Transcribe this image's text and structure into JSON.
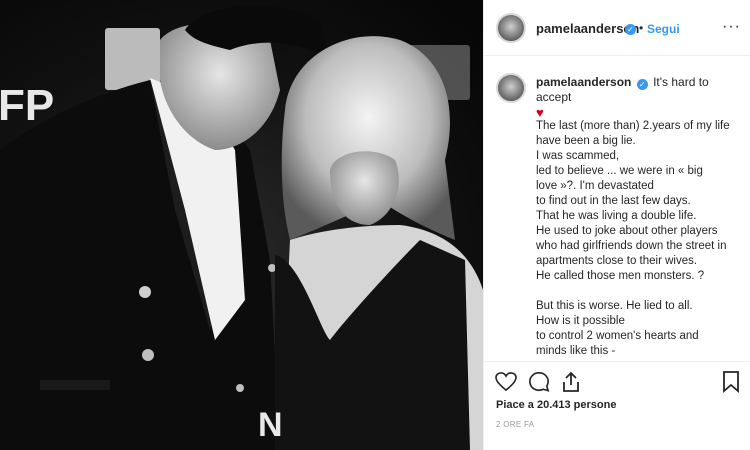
{
  "post": {
    "username": "pamelaanderson",
    "verified_icon": "verified-badge-icon",
    "separator": "•",
    "follow_label": "Segui",
    "more_icon": "more-options-icon",
    "more_label": "···"
  },
  "caption": {
    "username": "pamelaanderson",
    "first_line": "It's hard to accept",
    "heart": "♥",
    "body": "The last (more than) 2.years of my life\nhave been a big lie.\nI was scammed,\nled to believe ... we were in « big\nlove »?. I'm devastated\nto find out in the last few days.\nThat he was living a double life.\nHe used to joke about other players\nwho had girlfriends down the street in\napartments close to their wives.\nHe called those men monsters. ?\n\nBut this is worse. He lied to all.\nHow is it possible\nto control 2 women's hearts and\nminds like this -\nI'm sure there were others"
  },
  "actions": {
    "like_icon": "heart-icon",
    "comment_icon": "comment-icon",
    "share_icon": "share-icon",
    "save_icon": "bookmark-icon",
    "likes_text": "Piace a 20.413 persone",
    "time_text": "2 ORE FA"
  },
  "photo": {
    "description_icon": "post-photo",
    "sign_text": "FP",
    "sign_text2": "N"
  },
  "colors": {
    "link_blue": "#3897f0",
    "heart_red": "#d0021b",
    "border": "#efefef"
  }
}
